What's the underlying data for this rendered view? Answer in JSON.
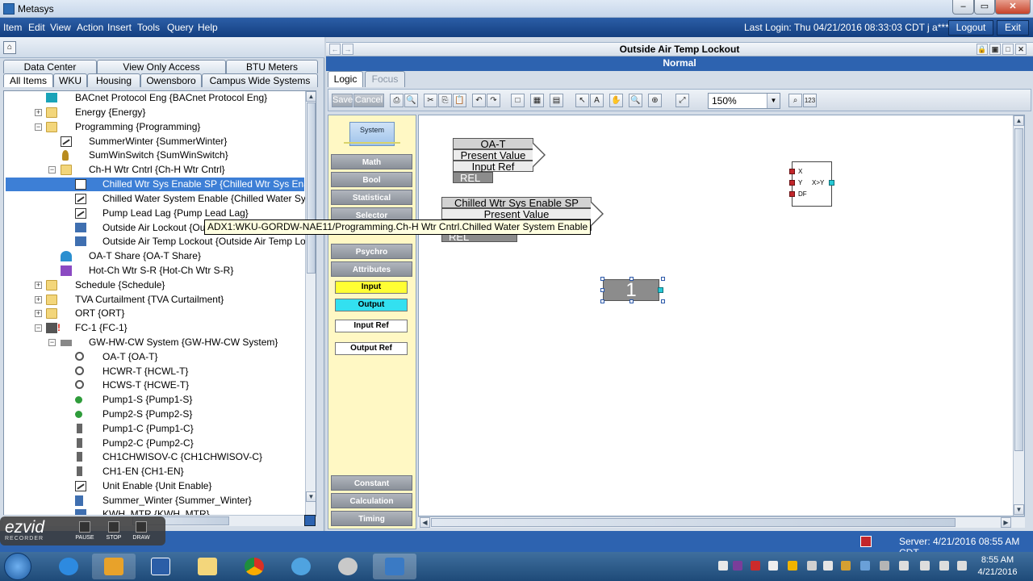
{
  "window": {
    "title": "Metasys"
  },
  "menu": {
    "items": [
      "Item",
      "Edit",
      "View",
      "Action",
      "Insert",
      "Tools",
      "Query",
      "Help"
    ],
    "last_login": "Last Login: Thu 04/21/2016 08:33:03 CDT j a***",
    "logout": "Logout",
    "exit": "Exit"
  },
  "left": {
    "tabs_row1": [
      "Data Center",
      "View Only Access",
      "BTU Meters"
    ],
    "tabs_row2": [
      "All Items",
      "WKU",
      "Housing",
      "Owensboro",
      "Campus Wide Systems"
    ],
    "tree": [
      {
        "label": "BACnet Protocol Eng {BACnet Protocol Eng}"
      },
      {
        "label": "Energy {Energy}"
      },
      {
        "label": "Programming {Programming}"
      },
      {
        "label": "SummerWinter {SummerWinter}"
      },
      {
        "label": "SumWinSwitch {SumWinSwitch}"
      },
      {
        "label": "Ch-H Wtr Cntrl {Ch-H Wtr Cntrl}"
      },
      {
        "label": "Chilled Wtr Sys Enable SP {Chilled Wtr Sys Enab"
      },
      {
        "label": "Chilled Water System Enable {Chilled Water Syst"
      },
      {
        "label": "Pump Lead Lag {Pump Lead Lag}"
      },
      {
        "label": "Outside Air Lockout {Outs"
      },
      {
        "label": "Outside Air Temp Lockout {Outside Air Temp Loc"
      },
      {
        "label": "OA-T Share {OA-T Share}"
      },
      {
        "label": "Hot-Ch Wtr S-R {Hot-Ch Wtr S-R}"
      },
      {
        "label": "Schedule {Schedule}"
      },
      {
        "label": "TVA Curtailment {TVA Curtailment}"
      },
      {
        "label": "ORT {ORT}"
      },
      {
        "label": "FC-1 {FC-1}"
      },
      {
        "label": "GW-HW-CW System {GW-HW-CW System}"
      },
      {
        "label": "OA-T {OA-T}"
      },
      {
        "label": "HCWR-T {HCWL-T}"
      },
      {
        "label": "HCWS-T {HCWE-T}"
      },
      {
        "label": "Pump1-S {Pump1-S}"
      },
      {
        "label": "Pump2-S {Pump2-S}"
      },
      {
        "label": "Pump1-C {Pump1-C}"
      },
      {
        "label": "Pump2-C {Pump2-C}"
      },
      {
        "label": "CH1CHWISOV-C {CH1CHWISOV-C}"
      },
      {
        "label": "CH1-EN {CH1-EN}"
      },
      {
        "label": "Unit Enable {Unit Enable}"
      },
      {
        "label": "Summer_Winter {Summer_Winter}"
      },
      {
        "label": "KWH_MTR {KWH_MTR}"
      }
    ],
    "tooltip": "ADX1:WKU-GORDW-NAE11/Programming.Ch-H Wtr Cntrl.Chilled Water System Enable"
  },
  "ezvid": {
    "logo": "ezvid",
    "sub": "RECORDER",
    "buttons": [
      "PAUSE",
      "STOP",
      "DRAW"
    ]
  },
  "right": {
    "title": "Outside Air Temp Lockout",
    "status": "Normal",
    "tabs": [
      "Logic",
      "Focus"
    ],
    "save": "Save",
    "cancel": "Cancel",
    "zoom": "150%",
    "palette": {
      "system": "System",
      "groups": [
        "Math",
        "Bool",
        "Statistical",
        "Selector",
        "Psychro",
        "Attributes"
      ],
      "attributes": [
        "Input",
        "Output",
        "Input Ref",
        "Output Ref"
      ],
      "bottom": [
        "Constant",
        "Calculation",
        "Timing"
      ]
    },
    "blocks": {
      "oat": {
        "name": "OA-T",
        "attr1": "Present Value",
        "attr2": "Input Ref",
        "type": "REL"
      },
      "cwse": {
        "name": "Chilled Wtr Sys Enable SP",
        "attr1": "Present Value",
        "type": "REL"
      },
      "compare": {
        "inputs": [
          "X",
          "Y",
          "DF"
        ],
        "op": "X>Y"
      },
      "constant": {
        "value": "1"
      }
    }
  },
  "status": {
    "server": "Server: 4/21/2016 08:55 AM CDT"
  },
  "taskbar": {
    "time": "8:55 AM",
    "date": "4/21/2016"
  }
}
